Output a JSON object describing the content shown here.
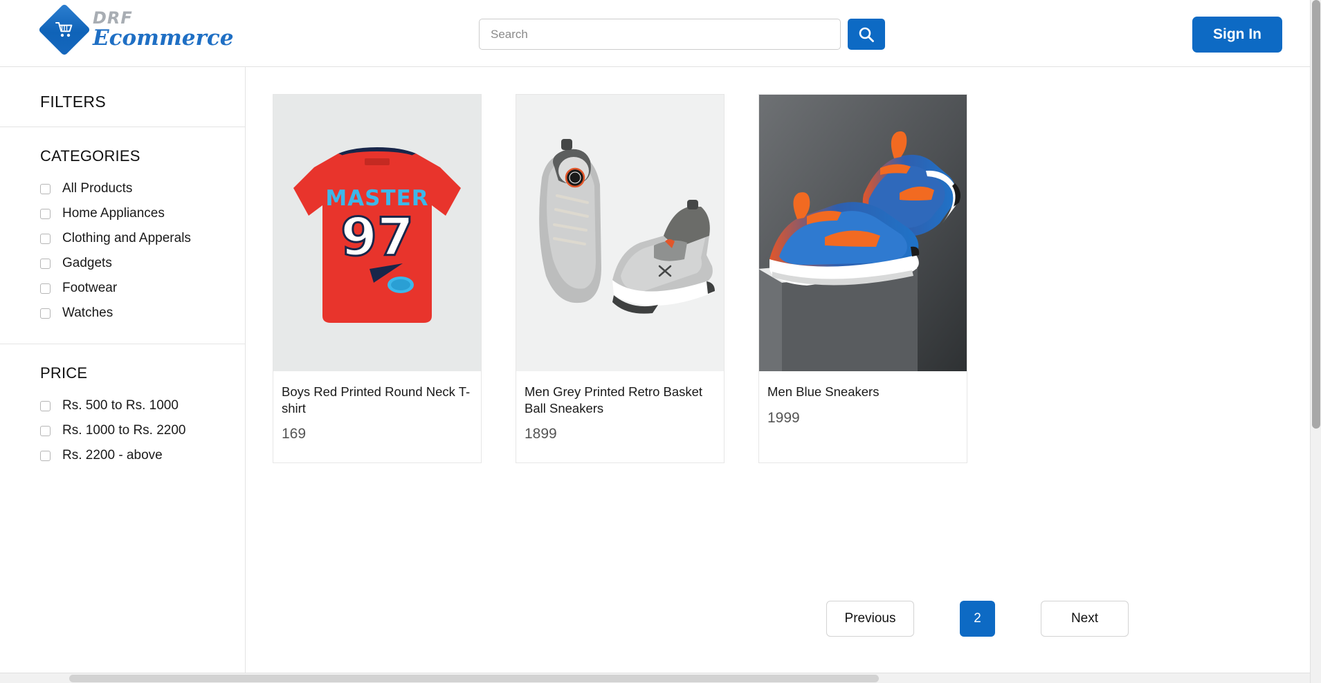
{
  "header": {
    "logo": {
      "primary": "DRF",
      "secondary": "Ecommerce",
      "icon": "shopping-cart-icon"
    },
    "search": {
      "value": "",
      "placeholder": "Search",
      "button_icon": "search-icon"
    },
    "signin_label": "Sign In"
  },
  "sidebar": {
    "title": "FILTERS",
    "sections": [
      {
        "title": "CATEGORIES",
        "options": [
          {
            "label": "All Products",
            "checked": false
          },
          {
            "label": "Home Appliances",
            "checked": false
          },
          {
            "label": "Clothing and Apperals",
            "checked": false
          },
          {
            "label": "Gadgets",
            "checked": false
          },
          {
            "label": "Footwear",
            "checked": false
          },
          {
            "label": "Watches",
            "checked": false
          }
        ]
      },
      {
        "title": "PRICE",
        "options": [
          {
            "label": "Rs. 500 to Rs. 1000",
            "checked": false
          },
          {
            "label": "Rs. 1000 to Rs. 2200",
            "checked": false
          },
          {
            "label": "Rs. 2200 - above",
            "checked": false
          }
        ]
      }
    ]
  },
  "products": [
    {
      "title": "Boys Red Printed Round Neck T-shirt",
      "price": "169",
      "image_alt": "red-tshirt-master-97",
      "graphic_text_top": "MASTER",
      "graphic_text_number": "97"
    },
    {
      "title": "Men Grey Printed Retro Basket Ball Sneakers",
      "price": "1899",
      "image_alt": "grey-retro-basketball-sneakers"
    },
    {
      "title": "Men Blue Sneakers",
      "price": "1999",
      "image_alt": "blue-orange-running-sneakers"
    }
  ],
  "pagination": {
    "previous_label": "Previous",
    "current_page": "2",
    "next_label": "Next"
  },
  "colors": {
    "brand_blue": "#0d6ac4",
    "logo_gray": "#a8adb3",
    "text_dark": "#1a1a1a",
    "price_gray": "#555555",
    "border": "#e4e4e4"
  }
}
